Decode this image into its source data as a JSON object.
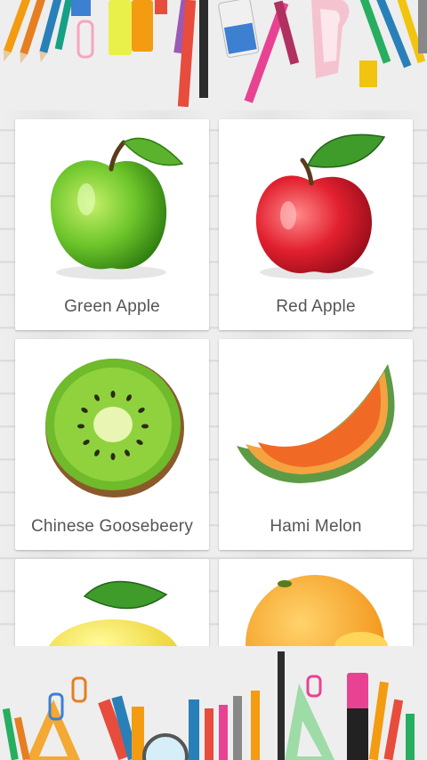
{
  "fruits": [
    {
      "name": "Green Apple",
      "icon": "green-apple-icon"
    },
    {
      "name": "Red Apple",
      "icon": "red-apple-icon"
    },
    {
      "name": "Chinese Goosebeery",
      "icon": "kiwi-icon"
    },
    {
      "name": "Hami Melon",
      "icon": "melon-icon"
    },
    {
      "name": "",
      "icon": "lemon-icon"
    },
    {
      "name": "",
      "icon": "orange-icon"
    }
  ],
  "colors": {
    "background": "#e9e9e9",
    "card": "#ffffff",
    "label_text": "#555555"
  }
}
